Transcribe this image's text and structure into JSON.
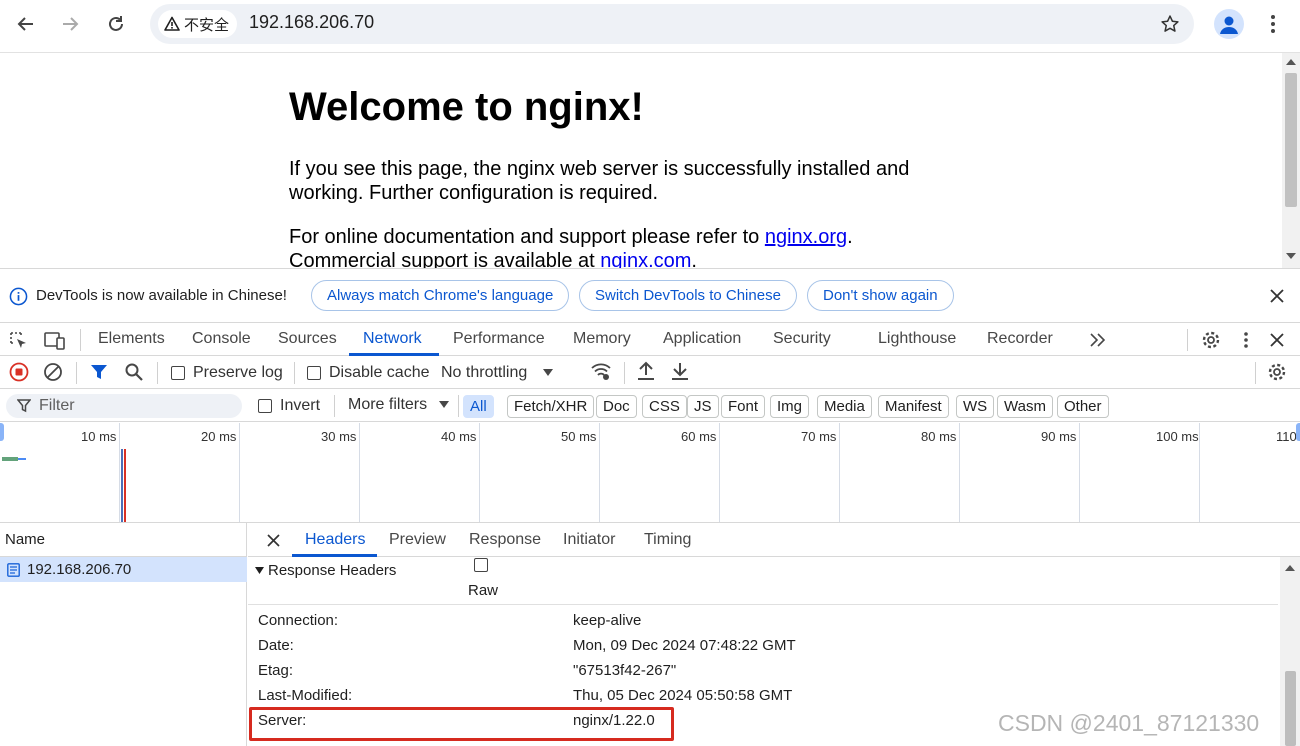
{
  "browser": {
    "security_label": "不安全",
    "url": "192.168.206.70"
  },
  "page": {
    "heading": "Welcome to nginx!",
    "para1_line1": "If you see this page, the nginx web server is successfully installed and",
    "para1_line2": "working. Further configuration is required.",
    "para2_prefix": "For online documentation and support please refer to ",
    "para2_link": "nginx.org",
    "para2_suffix": ".",
    "para3_prefix": "Commercial support is available at ",
    "para3_link": "nginx.com",
    "para3_suffix": "."
  },
  "infobar": {
    "message": "DevTools is now available in Chinese!",
    "btn_match": "Always match Chrome's language",
    "btn_switch": "Switch DevTools to Chinese",
    "btn_dont_show": "Don't show again"
  },
  "devtools_tabs": [
    "Elements",
    "Console",
    "Sources",
    "Network",
    "Performance",
    "Memory",
    "Application",
    "Security",
    "Lighthouse",
    "Recorder"
  ],
  "active_tab": "Network",
  "network_toolbar": {
    "preserve_log": "Preserve log",
    "disable_cache": "Disable cache",
    "throttling": "No throttling"
  },
  "filter_bar": {
    "placeholder": "Filter",
    "invert": "Invert",
    "more_filters": "More filters",
    "types": [
      "All",
      "Fetch/XHR",
      "Doc",
      "CSS",
      "JS",
      "Font",
      "Img",
      "Media",
      "Manifest",
      "WS",
      "Wasm",
      "Other"
    ]
  },
  "timeline_ticks": [
    "10 ms",
    "20 ms",
    "30 ms",
    "40 ms",
    "50 ms",
    "60 ms",
    "70 ms",
    "80 ms",
    "90 ms",
    "100 ms",
    "110"
  ],
  "requests": {
    "column": "Name",
    "items": [
      "192.168.206.70"
    ]
  },
  "detail": {
    "tabs": [
      "Headers",
      "Preview",
      "Response",
      "Initiator",
      "Timing"
    ],
    "active": "Headers",
    "section": "Response Headers",
    "raw_label": "Raw",
    "headers": [
      {
        "name": "Connection:",
        "value": "keep-alive"
      },
      {
        "name": "Date:",
        "value": "Mon, 09 Dec 2024 07:48:22 GMT"
      },
      {
        "name": "Etag:",
        "value": "\"67513f42-267\""
      },
      {
        "name": "Last-Modified:",
        "value": "Thu, 05 Dec 2024 05:50:58 GMT"
      },
      {
        "name": "Server:",
        "value": "nginx/1.22.0"
      }
    ]
  },
  "watermark": "CSDN @2401_87121330",
  "colors": {
    "accent": "#0b57d0",
    "highlight": "#d62a1f",
    "record_red": "#d93025"
  }
}
